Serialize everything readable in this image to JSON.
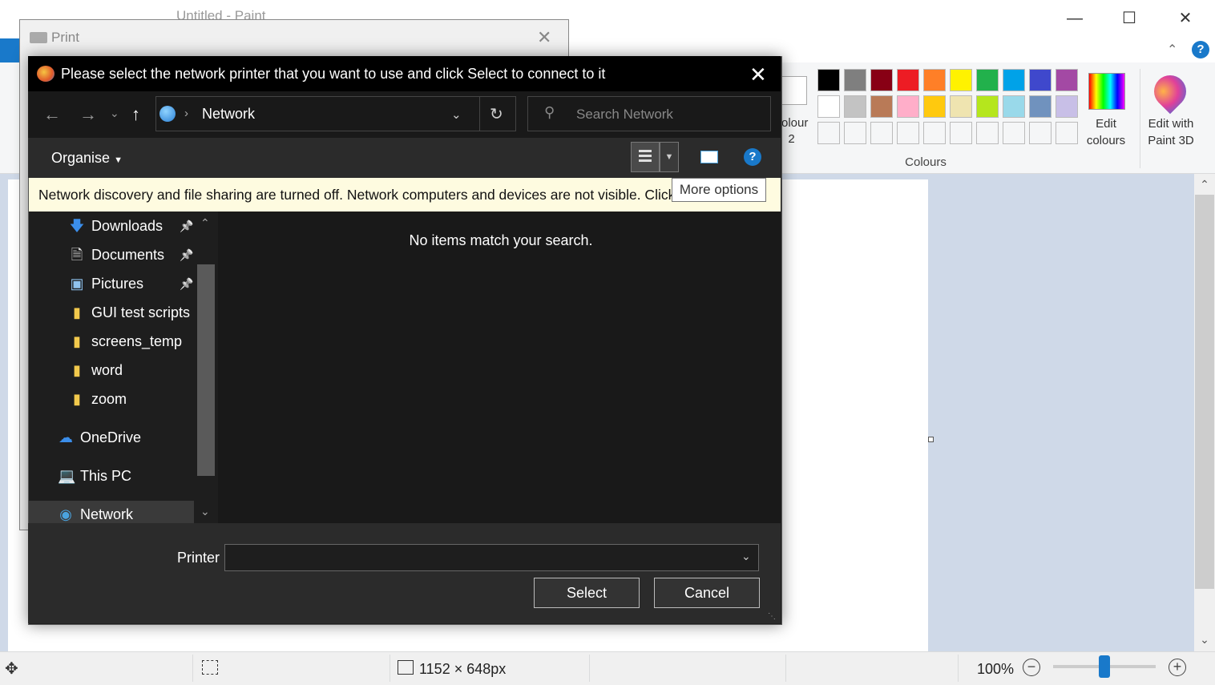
{
  "paint": {
    "title": "Untitled - Paint",
    "colour2_label": "olour\n2",
    "colours_group_label": "Colours",
    "edit_colours_label": "Edit colours",
    "edit_paint3d_label": "Edit with Paint 3D",
    "palette_row1": [
      "#000000",
      "#7f7f7f",
      "#880015",
      "#ed1c24",
      "#ff7f27",
      "#fff200",
      "#22b14c",
      "#00a2e8",
      "#3f48cc",
      "#a349a4"
    ],
    "palette_row2": [
      "#ffffff",
      "#c3c3c3",
      "#b97a57",
      "#ffaec9",
      "#ffc90e",
      "#efe4b0",
      "#b5e61d",
      "#99d9ea",
      "#7092be",
      "#c8bfe7"
    ],
    "status_size": "1152 × 648px",
    "status_zoom": "100%",
    "zoom_level_percent": 100
  },
  "print_dialog": {
    "title": "Print"
  },
  "network_dialog": {
    "title": "Please select the network printer that you want to use and click Select to connect to it",
    "address": "Network",
    "search_placeholder": "Search Network",
    "organise_label": "Organise",
    "info_bar": "Network discovery and file sharing are turned off. Network computers and devices are not visible. Click",
    "tooltip": "More options",
    "nav_items": [
      {
        "label": "Downloads",
        "icon": "download-arrow-icon",
        "pinned": true
      },
      {
        "label": "Documents",
        "icon": "document-icon",
        "pinned": true
      },
      {
        "label": "Pictures",
        "icon": "pictures-icon",
        "pinned": true
      },
      {
        "label": "GUI test scripts",
        "icon": "folder-icon",
        "pinned": false
      },
      {
        "label": "screens_temp",
        "icon": "folder-icon",
        "pinned": false
      },
      {
        "label": "word",
        "icon": "folder-icon",
        "pinned": false
      },
      {
        "label": "zoom",
        "icon": "folder-icon",
        "pinned": false
      },
      {
        "label": "OneDrive",
        "icon": "cloud-icon",
        "pinned": false
      },
      {
        "label": "This PC",
        "icon": "computer-icon",
        "pinned": false
      },
      {
        "label": "Network",
        "icon": "network-icon",
        "pinned": false
      }
    ],
    "empty_message": "No items match your search.",
    "printer_label": "Printer",
    "printer_value": "",
    "select_button": "Select",
    "cancel_button": "Cancel"
  }
}
